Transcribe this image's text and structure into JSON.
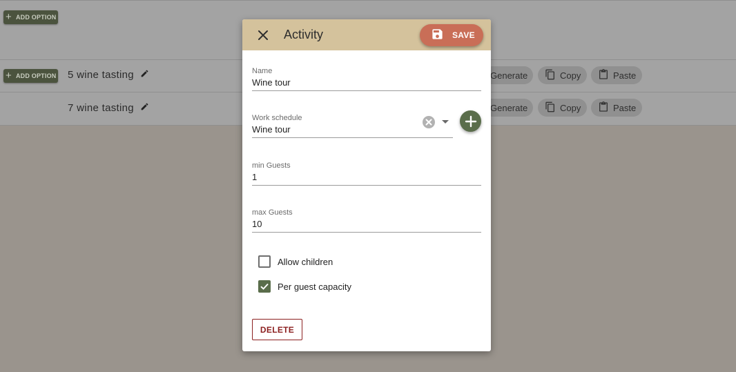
{
  "background": {
    "add_option_label": "ADD OPTION",
    "rows": [
      {
        "label": "5 wine tasting"
      },
      {
        "label": "7 wine tasting"
      }
    ],
    "chips": {
      "generate": "Generate",
      "copy": "Copy",
      "paste": "Paste"
    }
  },
  "dialog": {
    "title": "Activity",
    "save_label": "SAVE",
    "fields": {
      "name": {
        "label": "Name",
        "value": "Wine tour"
      },
      "work_schedule": {
        "label": "Work schedule",
        "value": "Wine tour"
      },
      "min_guests": {
        "label": "min Guests",
        "value": "1"
      },
      "max_guests": {
        "label": "max Guests",
        "value": "10"
      }
    },
    "checkboxes": {
      "allow_children": {
        "label": "Allow children",
        "checked": false
      },
      "per_guest_capacity": {
        "label": "Per guest capacity",
        "checked": true
      }
    },
    "delete_label": "DELETE"
  },
  "colors": {
    "header": "#d4c29c",
    "save": "#c96e57",
    "accent_green": "#5a6d4b",
    "delete": "#8b1e1e"
  },
  "icons": [
    "close-icon",
    "save-icon",
    "clear-icon",
    "dropdown-caret-icon",
    "add-icon",
    "pencil-icon",
    "copy-icon",
    "paste-icon",
    "check-icon"
  ]
}
